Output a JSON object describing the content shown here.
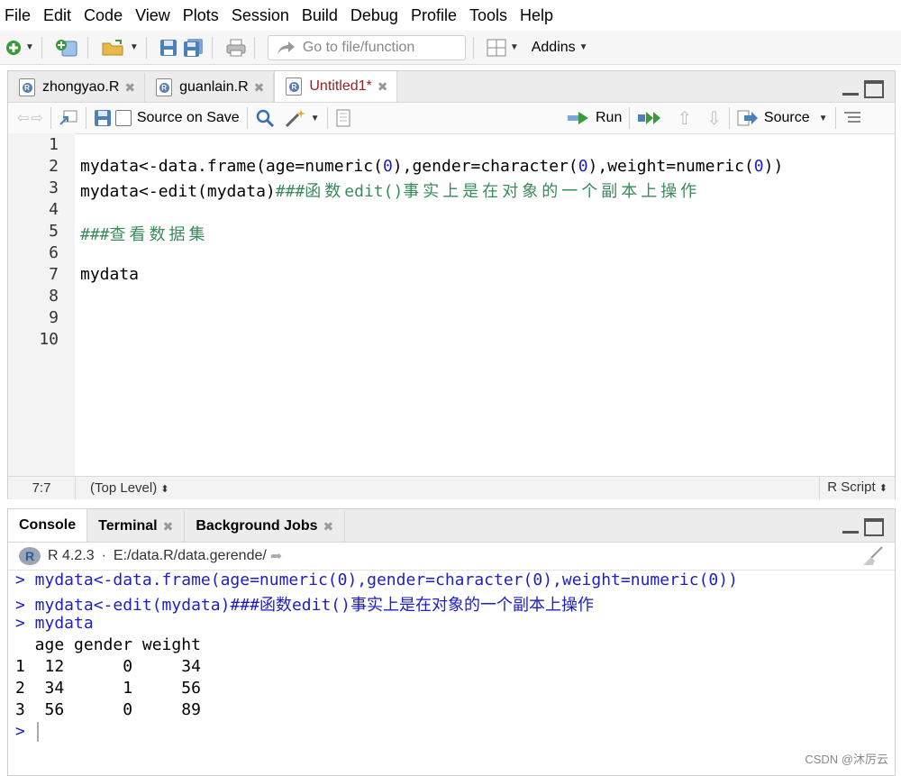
{
  "menu": [
    "File",
    "Edit",
    "Code",
    "View",
    "Plots",
    "Session",
    "Build",
    "Debug",
    "Profile",
    "Tools",
    "Help"
  ],
  "toolbar": {
    "goto_placeholder": "Go to file/function",
    "addins_label": "Addins"
  },
  "editor": {
    "tabs": [
      {
        "label": "zhongyao.R",
        "active": false
      },
      {
        "label": "guanlain.R",
        "active": false
      },
      {
        "label": "Untitled1*",
        "active": true
      }
    ],
    "source_on_save_label": "Source on Save",
    "run_label": "Run",
    "source_label": "Source",
    "line_numbers": [
      "1",
      "2",
      "3",
      "4",
      "5",
      "6",
      "7",
      "8",
      "9",
      "10"
    ],
    "lines": {
      "l2_a": "mydata<-data.frame(age=numeric(",
      "l2_b": "0",
      "l2_c": "),gender=character(",
      "l2_d": "0",
      "l2_e": "),weight=numeric(",
      "l2_f": "0",
      "l2_g": "))",
      "l3_a": "mydata<-edit(mydata)",
      "l3_b": "###",
      "l3_c": "函数",
      "l3_d": "edit()",
      "l3_e": "事实上是在对象的一个副本上操作",
      "l5_a": "###",
      "l5_b": "查看数据集",
      "l7": "mydata"
    },
    "status": {
      "position": "7:7",
      "scope": "(Top Level)",
      "filetype": "R Script"
    }
  },
  "console": {
    "tabs": [
      {
        "label": "Console",
        "active": true
      },
      {
        "label": "Terminal",
        "active": false
      },
      {
        "label": "Background Jobs",
        "active": false
      }
    ],
    "r_version": "R 4.2.3",
    "path": "E:/data.R/data.gerende/",
    "lines": {
      "c1": "> mydata<-data.frame(age=numeric(0),gender=character(0),weight=numeric(0))",
      "c2_a": "> mydata<-edit(mydata)###",
      "c2_b": "函数",
      "c2_c": "edit()",
      "c2_d": "事实上是在对象的一个副本上操作",
      "c3": "> mydata",
      "c4": "  age gender weight",
      "c5": "1  12      0     34",
      "c6": "2  34      1     56",
      "c7": "3  56      0     89",
      "c8": "> "
    }
  },
  "watermark": "CSDN @沐厉云"
}
